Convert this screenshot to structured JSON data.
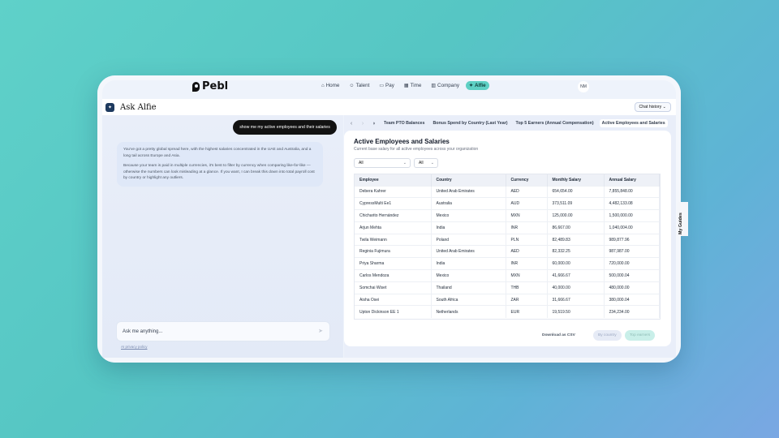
{
  "nav": {
    "brand": "Pebl",
    "items": [
      {
        "label": "Home",
        "icon": "home-icon",
        "glyph": "⌂"
      },
      {
        "label": "Talent",
        "icon": "person-icon",
        "glyph": "☺"
      },
      {
        "label": "Pay",
        "icon": "wallet-icon",
        "glyph": "▭"
      },
      {
        "label": "Time",
        "icon": "calendar-icon",
        "glyph": "▦"
      },
      {
        "label": "Company",
        "icon": "building-icon",
        "glyph": "▥"
      },
      {
        "label": "Alfie",
        "icon": "sparkle-icon",
        "glyph": "✦"
      }
    ],
    "active": "Alfie",
    "avatar": "NM"
  },
  "header": {
    "title": "Ask Alfie",
    "chat_history": "Chat history"
  },
  "chat": {
    "user_message": "show me my active employees and their salaries",
    "bot_p1": "You've got a pretty global spread here, with the highest salaries concentrated in the UAE and Australia, and a long tail across Europe and Asia.",
    "bot_p2": "Because your team is paid in multiple currencies, it's best to filter by currency when comparing like-for-like — otherwise the numbers can look misleading at a glance. If you want, I can break this down into total payroll cost by country or highlight any outliers.",
    "input_placeholder": "Ask me anything...",
    "privacy": "AI privacy policy"
  },
  "tabs": [
    {
      "label": "Team PTO Balances"
    },
    {
      "label": "Bonus Spend by Country (Last Year)"
    },
    {
      "label": "Top 5 Earners (Annual Compensation)"
    },
    {
      "label": "Active Employees and Salaries"
    }
  ],
  "card": {
    "title": "Active Employees and Salaries",
    "subtitle": "Current base salary for all active employees across your organization",
    "filter1": "All",
    "filter2": "All",
    "columns": [
      "Employee",
      "Country",
      "Currency",
      "Monthly Salary",
      "Annual Salary"
    ],
    "rows": [
      [
        "Debera Kahrer",
        "United Arab Emirates",
        "AED",
        "654,654.00",
        "7,855,848.00"
      ],
      [
        "CypressMulti Ee1",
        "Australia",
        "AUD",
        "373,511.09",
        "4,482,133.08"
      ],
      [
        "Chicharito Hernández",
        "Mexico",
        "MXN",
        "125,000.00",
        "1,500,000.00"
      ],
      [
        "Arjun Mehta",
        "India",
        "INR",
        "86,667.00",
        "1,040,004.00"
      ],
      [
        "Twila Weimann",
        "Poland",
        "PLN",
        "82,489.83",
        "989,877.96"
      ],
      [
        "Reginia Fujimura",
        "United Arab Emirates",
        "AED",
        "82,332.25",
        "987,987.00"
      ],
      [
        "Priya Sharma",
        "India",
        "INR",
        "60,000.00",
        "720,000.00"
      ],
      [
        "Carlos Mendoza",
        "Mexico",
        "MXN",
        "41,666.67",
        "500,000.04"
      ],
      [
        "Somchai Wiset",
        "Thailand",
        "THB",
        "40,000.00",
        "480,000.00"
      ],
      [
        "Aisha Osei",
        "South Africa",
        "ZAR",
        "31,666.67",
        "380,000.04"
      ],
      [
        "Upton Dickinson EE 1",
        "Netherlands",
        "EUR",
        "19,519.50",
        "234,234.00"
      ]
    ],
    "download": "Download as CSV",
    "by_country": "By country",
    "top_earners": "Top earners"
  },
  "guides": "My Guides"
}
